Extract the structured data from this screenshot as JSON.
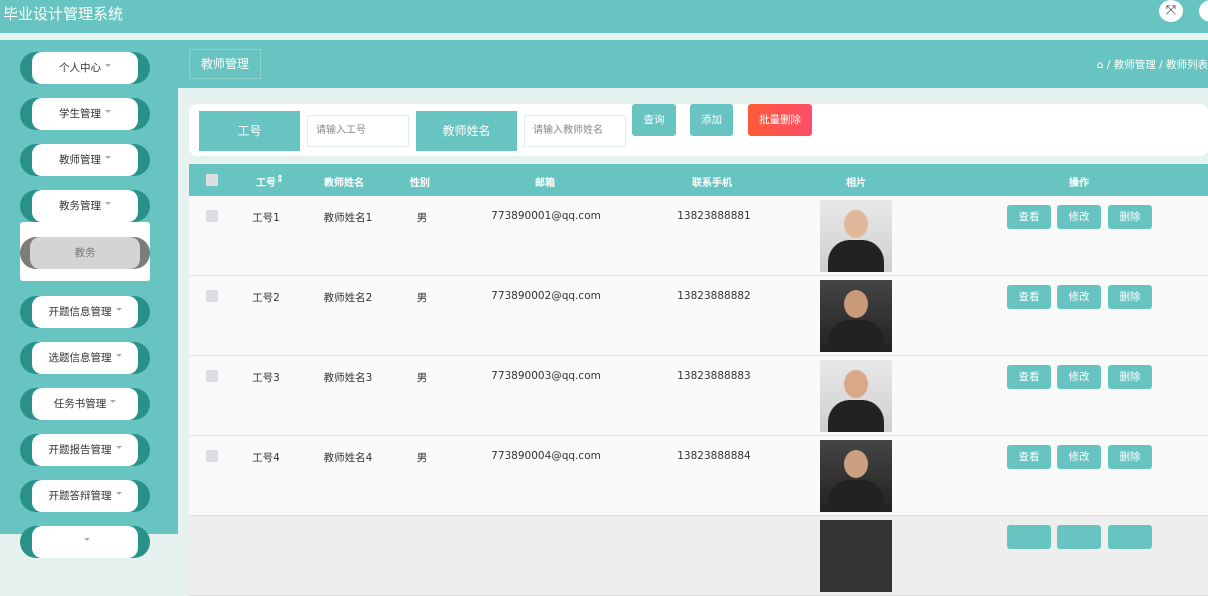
{
  "app": {
    "title": "毕业设计管理系统",
    "fullscreen_icon": "expand-icon"
  },
  "sidebar": {
    "items": [
      {
        "label": "个人中心"
      },
      {
        "label": "学生管理"
      },
      {
        "label": "教师管理"
      },
      {
        "label": "教务管理"
      },
      {
        "label": "开题信息管理"
      },
      {
        "label": "选题信息管理"
      },
      {
        "label": "任务书管理"
      },
      {
        "label": "开题报告管理"
      },
      {
        "label": "开题答辩管理"
      }
    ],
    "submenu": {
      "label": "教务"
    }
  },
  "page": {
    "tag": "教师管理",
    "breadcrumb": [
      "教师管理",
      "教师列表"
    ]
  },
  "search": {
    "id_label": "工号",
    "id_placeholder": "请输入工号",
    "name_label": "教师姓名",
    "name_placeholder": "请输入教师姓名",
    "query": "查询",
    "add": "添加",
    "batch_delete": "批量删除"
  },
  "table": {
    "headers": {
      "id": "工号",
      "name": "教师姓名",
      "gender": "性别",
      "email": "邮箱",
      "phone": "联系手机",
      "photo": "相片",
      "ops": "操作"
    },
    "actions": {
      "view": "查看",
      "edit": "修改",
      "delete": "删除"
    },
    "rows": [
      {
        "id": "工号1",
        "name": "教师姓名1",
        "gender": "男",
        "email": "773890001@qq.com",
        "phone": "13823888881"
      },
      {
        "id": "工号2",
        "name": "教师姓名2",
        "gender": "男",
        "email": "773890002@qq.com",
        "phone": "13823888882"
      },
      {
        "id": "工号3",
        "name": "教师姓名3",
        "gender": "男",
        "email": "773890003@qq.com",
        "phone": "13823888883"
      },
      {
        "id": "工号4",
        "name": "教师姓名4",
        "gender": "男",
        "email": "773890004@qq.com",
        "phone": "13823888884"
      }
    ]
  }
}
